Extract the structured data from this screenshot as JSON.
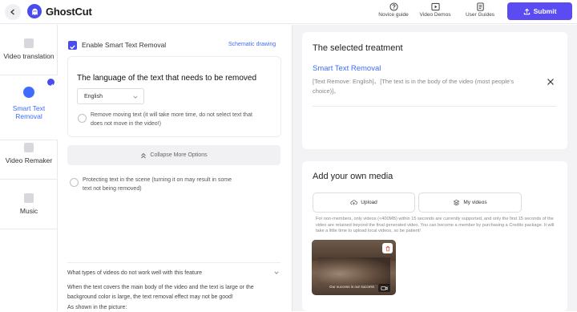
{
  "header": {
    "brand": "GhostCut",
    "nav": [
      {
        "label": "Novice guide",
        "icon": "question-icon"
      },
      {
        "label": "Video Demos",
        "icon": "play-icon"
      },
      {
        "label": "User Guides",
        "icon": "book-icon"
      }
    ],
    "submit_label": "Submit"
  },
  "sidebar": {
    "items": [
      {
        "label": "Video translation",
        "icon": "translate-icon"
      },
      {
        "label": "Smart Text Removal",
        "icon": "eraser-icon",
        "active": true
      },
      {
        "label": "Video Remaker",
        "icon": "remake-icon"
      },
      {
        "label": "Music",
        "icon": "music-icon"
      }
    ]
  },
  "settings": {
    "enable_label": "Enable Smart Text Removal",
    "schematic_link": "Schematic drawing",
    "language_heading": "The language of the text that needs to be removed",
    "language_value": "English",
    "remove_moving_text": "Remove moving text (it will take more time, do not select text that does not move in the video!)",
    "collapse_label": "Collapse More Options",
    "protect_text": "Protecting text in the scene (turning it on may result in some text not being removed)",
    "faq_title": "What types of videos do not work well with this feature",
    "faq_body": "When the text covers the main body of the video and the text is large or the background color is large, the text removal effect may not be good!",
    "faq_example": "As shown in the picture:"
  },
  "selected": {
    "heading": "The selected treatment",
    "item_title": "Smart Text Removal",
    "item_desc": "[Text Remove: English]、[The text is in the body of the video (most people's choice)]、"
  },
  "media": {
    "heading": "Add your own media",
    "upload_label": "Upload",
    "my_videos_label": "My videos",
    "notice": "For non-members, only videos (<400MB) within 15 seconds are currently supported, and only the first 15 seconds of the video are retained beyond the final generated video. You can become a member by purchasing a Credits package. It will take a little time to upload local videos, so be patient!",
    "thumb_caption": "Our success is our success"
  },
  "colors": {
    "accent": "#4b4cf0",
    "submit": "#5a4cf2",
    "link": "#3d6cff",
    "right_bg": "#f3f3f6"
  }
}
